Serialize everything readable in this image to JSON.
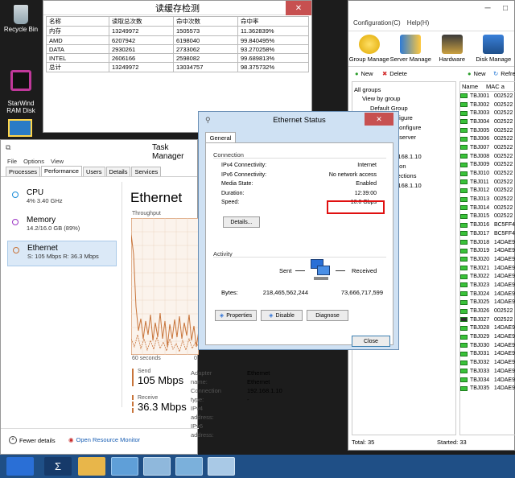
{
  "desktop": {
    "icons": [
      {
        "label": "Recycle Bin"
      },
      {
        "label": "StarWind\nRAM Disk"
      }
    ]
  },
  "cache_window": {
    "title": "读缓存检测",
    "headers": [
      "名称",
      "读取总次数",
      "命中次数",
      "命中率"
    ],
    "rows": [
      [
        "内存",
        "13249972",
        "1505573",
        "11.362839%"
      ],
      [
        "AMD",
        "6207942",
        "6198040",
        "99.840495%"
      ],
      [
        "DATA",
        "2930261",
        "2733062",
        "93.270258%"
      ],
      [
        "INTEL",
        "2606166",
        "2598082",
        "99.689813%"
      ],
      [
        "总计",
        "13249972",
        "13034757",
        "98.375732%"
      ]
    ]
  },
  "group_manager": {
    "menu": [
      "Configuration(C)",
      "Help(H)"
    ],
    "toolbar": [
      "Group Manage",
      "Server Manage",
      "Hardware",
      "Disk Manage"
    ],
    "left_buttons": [
      "New",
      "Delete"
    ],
    "right_buttons": [
      "New",
      "Refre"
    ],
    "tree": [
      "All groups",
      "View by group",
      "Default Group",
      "by configure",
      "efault configure",
      "by first server",
      "ot set",
      "92.168.1.10",
      "onnection",
      "ll connections",
      "92.168.1.10"
    ],
    "col_headers": [
      "Name",
      "MAC a"
    ],
    "clients": [
      [
        "TBJ001",
        "002522"
      ],
      [
        "TBJ002",
        "002522"
      ],
      [
        "TBJ003",
        "002522"
      ],
      [
        "TBJ004",
        "002522"
      ],
      [
        "TBJ005",
        "002522"
      ],
      [
        "TBJ006",
        "002522"
      ],
      [
        "TBJ007",
        "002522"
      ],
      [
        "TBJ008",
        "002522"
      ],
      [
        "TBJ009",
        "002522"
      ],
      [
        "TBJ010",
        "002522"
      ],
      [
        "TBJ011",
        "002522"
      ],
      [
        "TBJ012",
        "002522"
      ],
      [
        "TBJ013",
        "002522"
      ],
      [
        "TBJ014",
        "002522"
      ],
      [
        "TBJ015",
        "002522"
      ],
      [
        "TBJ016",
        "BC5FF4"
      ],
      [
        "TBJ017",
        "BC5FF4"
      ],
      [
        "TBJ018",
        "14DAE9"
      ],
      [
        "TBJ019",
        "14DAE9"
      ],
      [
        "TBJ020",
        "14DAE9"
      ],
      [
        "TBJ021",
        "14DAE9"
      ],
      [
        "TBJ022",
        "14DAE9"
      ],
      [
        "TBJ023",
        "14DAE9"
      ],
      [
        "TBJ024",
        "14DAE9"
      ],
      [
        "TBJ025",
        "14DAE9"
      ],
      [
        "TBJ026",
        "002522"
      ],
      [
        "TBJ027",
        "002522"
      ],
      [
        "TBJ028",
        "14DAE9"
      ],
      [
        "TBJ029",
        "14DAE9"
      ],
      [
        "TBJ030",
        "14DAE9"
      ],
      [
        "TBJ031",
        "14DAE9"
      ],
      [
        "TBJ032",
        "14DAE9"
      ],
      [
        "TBJ033",
        "14DAE9"
      ],
      [
        "TBJ034",
        "14DAE9"
      ],
      [
        "TBJ035",
        "14DAE9"
      ]
    ],
    "status_total": "Total: 35",
    "status_started": "Started: 33"
  },
  "task_manager": {
    "title": "Task Manager",
    "menu": [
      "File",
      "Options",
      "View"
    ],
    "tabs": [
      "Processes",
      "Performance",
      "Users",
      "Details",
      "Services"
    ],
    "side": [
      {
        "name": "CPU",
        "detail": "4% 3.40 GHz",
        "color": "#1a8cd8"
      },
      {
        "name": "Memory",
        "detail": "14.2/16.0 GB (89%)",
        "color": "#9b34c4"
      },
      {
        "name": "Ethernet",
        "detail": "S: 105 Mbps R: 36.3 Mbps",
        "color": "#c8743a"
      }
    ],
    "heading": "Ethernet",
    "throughput_label": "Throughput",
    "time_left": "60 seconds",
    "time_right": "0",
    "send_label": "Send",
    "send_value": "105 Mbps",
    "receive_label": "Receive",
    "receive_value": "36.3 Mbps",
    "details": [
      [
        "Adapter name:",
        "Ethernet"
      ],
      [
        "Connection type:",
        "Ethernet"
      ],
      [
        "IPv4 address:",
        "192.168.1.10"
      ],
      [
        "IPv6 address:",
        "-"
      ]
    ],
    "fewer_details": "Fewer details",
    "open_resource_monitor": "Open Resource Monitor"
  },
  "ethernet_status": {
    "title": "Ethernet Status",
    "tab": "General",
    "connection_label": "Connection",
    "rows": [
      [
        "IPv4 Connectivity:",
        "Internet"
      ],
      [
        "IPv6 Connectivity:",
        "No network access"
      ],
      [
        "Media State:",
        "Enabled"
      ],
      [
        "Duration:",
        "12:39:00"
      ],
      [
        "Speed:",
        "10.0 Gbps"
      ]
    ],
    "details_button": "Details...",
    "activity_label": "Activity",
    "sent_label": "Sent",
    "received_label": "Received",
    "bytes_label": "Bytes:",
    "bytes_sent": "218,465,562,244",
    "bytes_received": "73,666,717,599",
    "properties_button": "Properties",
    "disable_button": "Disable",
    "diagnose_button": "Diagnose",
    "close_button": "Close",
    "highlight_color": "#e01010"
  },
  "colors": {
    "taskbar": "#1f4f86",
    "ethernet_accent": "#c8743a"
  }
}
